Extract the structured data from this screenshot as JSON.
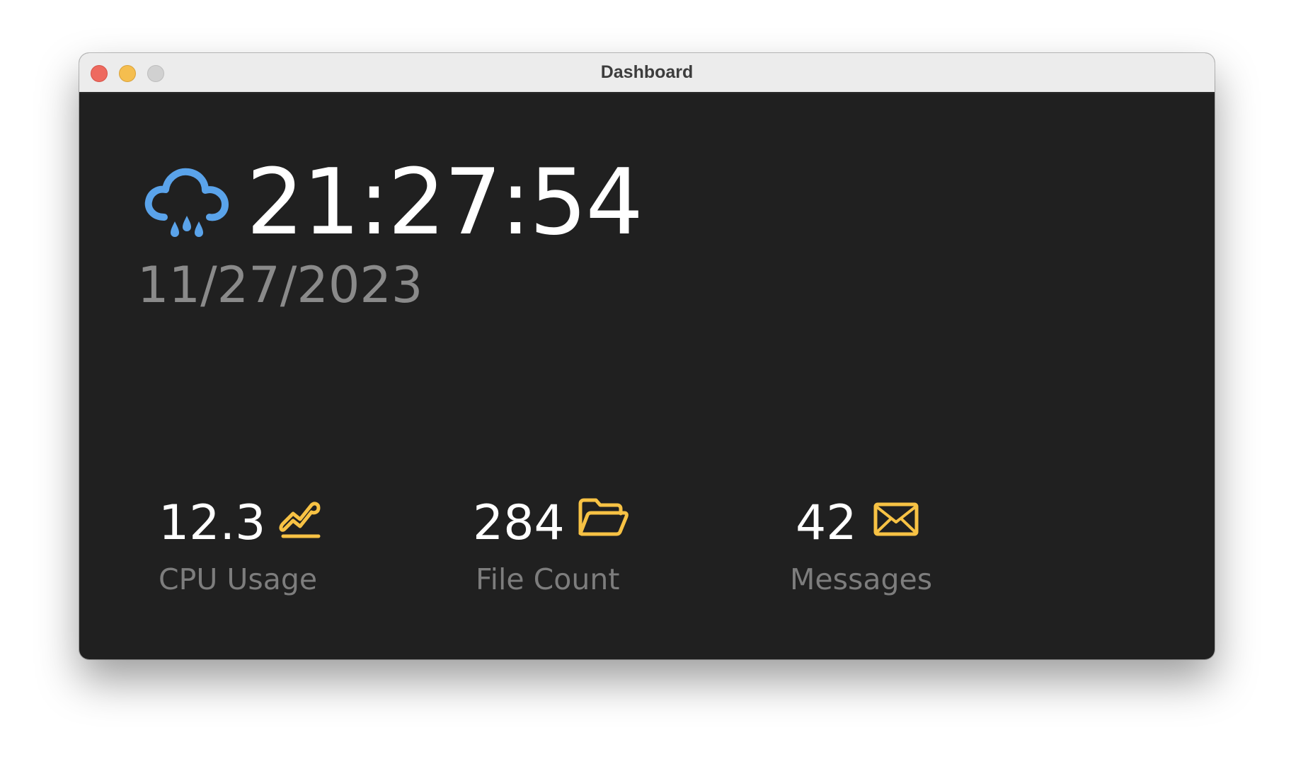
{
  "window": {
    "title": "Dashboard"
  },
  "clock": {
    "time": "21:27:54",
    "date": "11/27/2023",
    "weather_icon": "rain-cloud-icon"
  },
  "stats": [
    {
      "value": "12.3",
      "label": "CPU Usage",
      "icon": "chart-line-icon"
    },
    {
      "value": "284",
      "label": "File Count",
      "icon": "folder-open-icon"
    },
    {
      "value": "42",
      "label": "Messages",
      "icon": "envelope-icon"
    }
  ],
  "colors": {
    "background": "#202020",
    "accent_icon": "#f7c244",
    "weather_icon": "#5aa3ea",
    "primary_text": "#ffffff",
    "secondary_text": "#8a8a8a"
  }
}
